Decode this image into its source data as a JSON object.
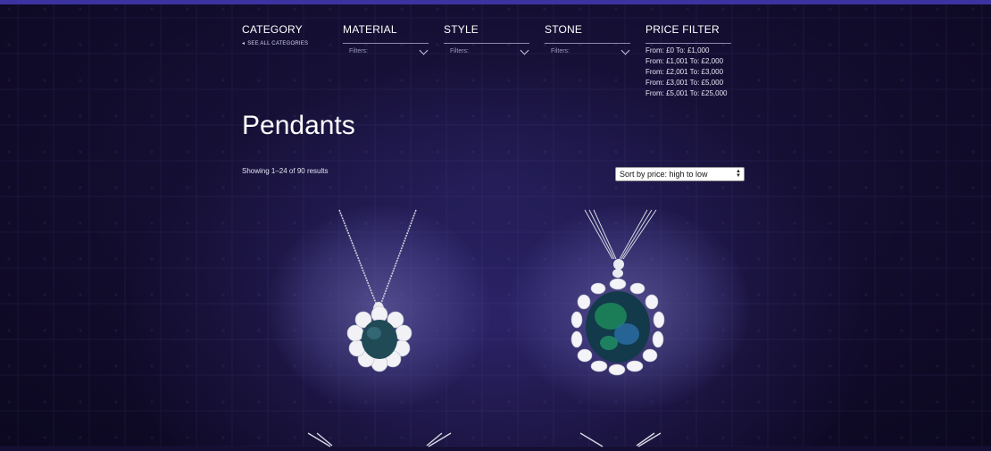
{
  "filters": {
    "category": {
      "heading": "CATEGORY",
      "see_all": "SEE ALL CATEGORIES"
    },
    "material": {
      "heading": "MATERIAL",
      "placeholder": "Filters:"
    },
    "style": {
      "heading": "STYLE",
      "placeholder": "Filters:"
    },
    "stone": {
      "heading": "STONE",
      "placeholder": "Filters:"
    },
    "price": {
      "heading": "PRICE FILTER",
      "ranges": [
        "From: £0 To: £1,000",
        "From: £1,001 To: £2,000",
        "From: £2,001 To: £3,000",
        "From: £3,001 To: £5,000",
        "From: £5,001 To: £25,000"
      ]
    }
  },
  "page": {
    "title": "Pendants",
    "results": "Showing 1–24 of 90 results"
  },
  "sort": {
    "selected": "Sort by price: high to low"
  },
  "colors": {
    "accent_bar": "#3a33a0",
    "background": "#150f33"
  },
  "products": [
    {
      "image": "sapphire-diamond-cluster-pendant"
    },
    {
      "image": "black-opal-diamond-cluster-pendant"
    }
  ]
}
